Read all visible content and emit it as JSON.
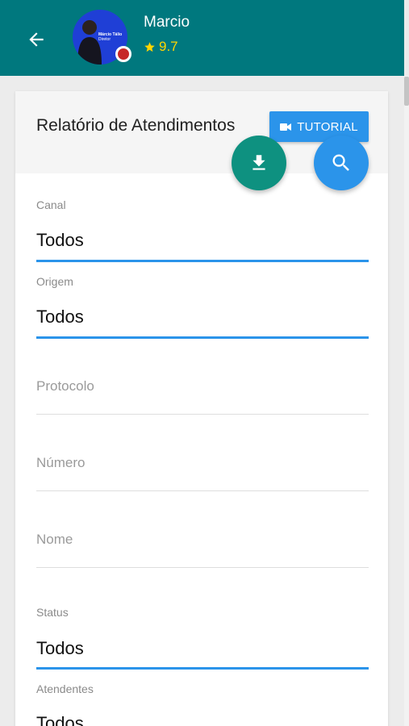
{
  "header": {
    "user_name": "Marcio",
    "rating": "9.7",
    "avatar_caption": "Márcio Tálio",
    "avatar_subcaption": "Diretor"
  },
  "card": {
    "title": "Relatório de Atendimentos",
    "tutorial_label": "TUTORIAL"
  },
  "fields": {
    "canal": {
      "label": "Canal",
      "value": "Todos"
    },
    "origem": {
      "label": "Origem",
      "value": "Todos"
    },
    "protocolo": {
      "placeholder": "Protocolo"
    },
    "numero": {
      "placeholder": "Número"
    },
    "nome": {
      "placeholder": "Nome"
    },
    "status": {
      "label": "Status",
      "value": "Todos"
    },
    "atendentes": {
      "label": "Atendentes",
      "value": "Todos"
    }
  },
  "icons": {
    "back": "arrow-left-icon",
    "star": "star-icon",
    "video": "video-camera-icon",
    "download": "download-icon",
    "search": "search-icon"
  },
  "colors": {
    "appbar": "#00787e",
    "accent_blue": "#2b94ea",
    "download_fab": "#0e9180",
    "status_dot": "#c62828",
    "rating": "#ffd600"
  }
}
